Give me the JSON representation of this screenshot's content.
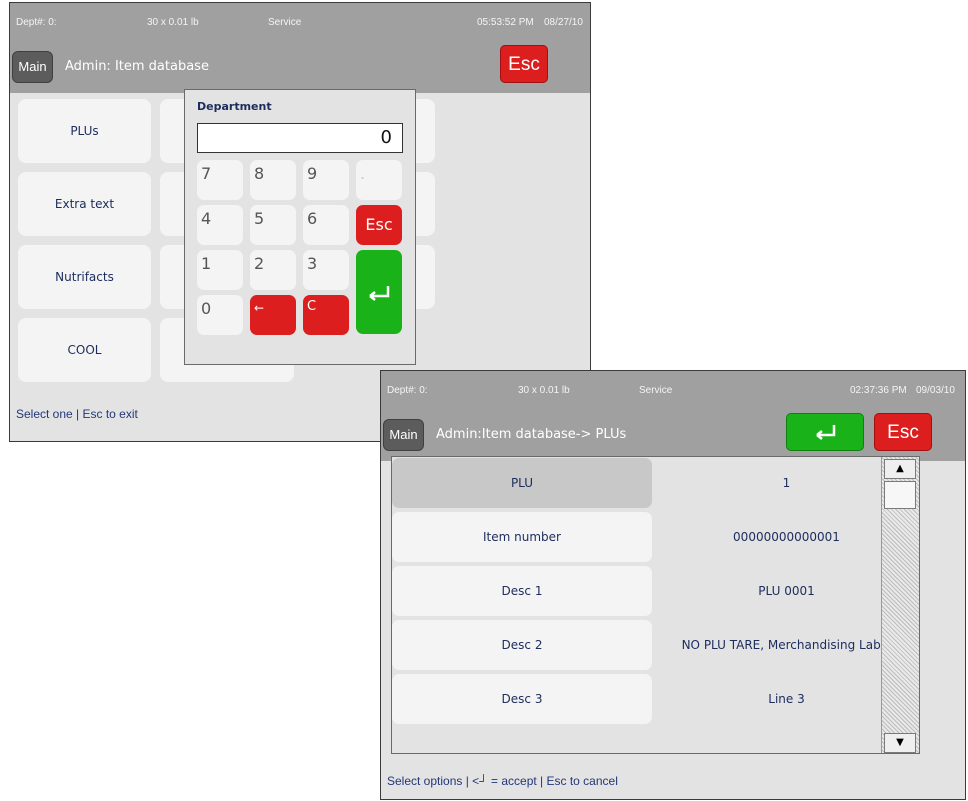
{
  "screen1": {
    "status": {
      "dept": "Dept#: 0:",
      "weight": "30 x 0.01 lb",
      "mode": "Service",
      "time": "05:53:52 PM",
      "date": "08/27/10"
    },
    "main_label": "Main",
    "title": "Admin: Item database",
    "esc_label": "Esc",
    "menu": [
      "PLUs",
      "Extra text",
      "Nutrifacts",
      "COOL"
    ],
    "hint": "Select one | Esc to exit",
    "keypad": {
      "title": "Department",
      "value": "0",
      "keys": {
        "k7": "7",
        "k8": "8",
        "k9": "9",
        "dot": ".",
        "k4": "4",
        "k5": "5",
        "k6": "6",
        "esc": "Esc",
        "k1": "1",
        "k2": "2",
        "k3": "3",
        "k0": "0",
        "back": "←",
        "clear": "C",
        "enter": "↵"
      }
    }
  },
  "screen2": {
    "status": {
      "dept": "Dept#: 0:",
      "weight": "30 x 0.01 lb",
      "mode": "Service",
      "time": "02:37:36 PM",
      "date": "09/03/10"
    },
    "main_label": "Main",
    "title": "Admin:Item database-> PLUs",
    "esc_label": "Esc",
    "rows": [
      {
        "label": "PLU",
        "value": "1"
      },
      {
        "label": "Item number",
        "value": "00000000000001"
      },
      {
        "label": "Desc 1",
        "value": "PLU 0001"
      },
      {
        "label": "Desc 2",
        "value": "NO PLU TARE, Merchandising Label"
      },
      {
        "label": "Desc 3",
        "value": "Line 3"
      }
    ],
    "scroll": {
      "up": "▲",
      "down": "▼"
    },
    "hint": "Select options | <┘ = accept | Esc to cancel"
  },
  "colors": {
    "accent_red": "#dd1e1e",
    "accent_green": "#19b319",
    "text_navy": "#1c2c5c",
    "bar_gray": "#a0a0a0"
  }
}
